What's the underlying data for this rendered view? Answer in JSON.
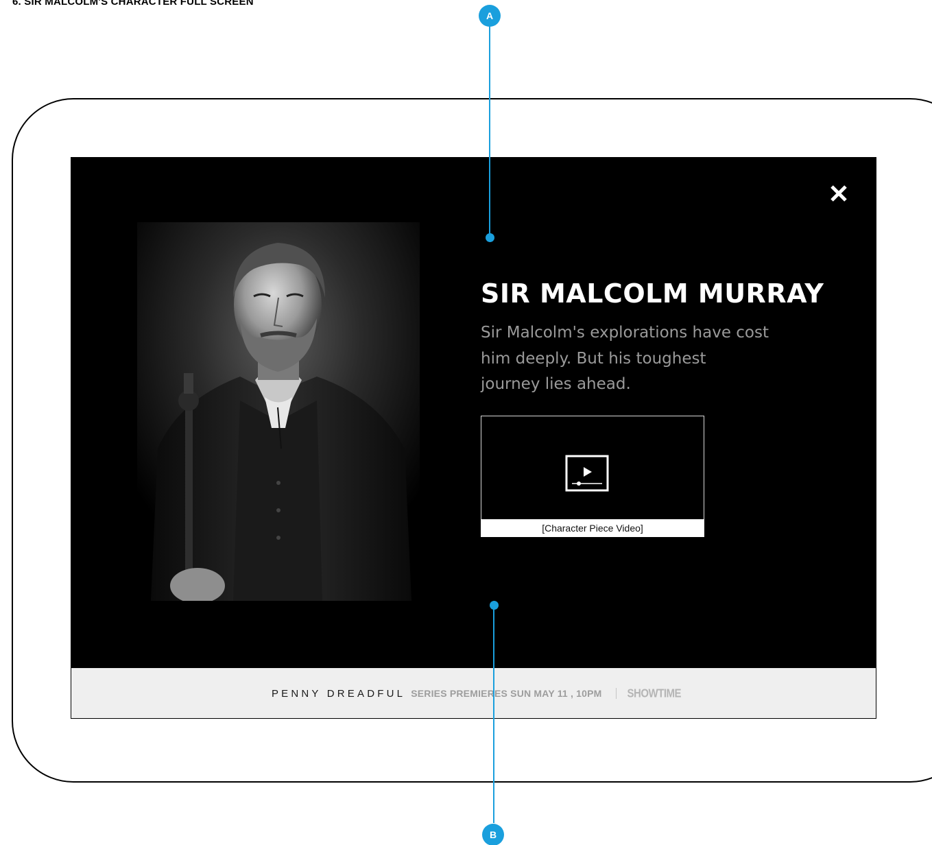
{
  "doc": {
    "title": "6. SIR MALCOLM'S CHARACTER FULL SCREEN"
  },
  "annotations": {
    "a_label": "A",
    "b_label": "B",
    "color": "#1a9fdd"
  },
  "modal": {
    "close_label": "X",
    "character_name": "SIR MALCOLM MURRAY",
    "description": "Sir Malcolm's explorations have cost him deeply. But his toughest journey lies ahead.",
    "video_caption": "[Character Piece Video]",
    "video_icon": "play-video-icon",
    "portrait_alt": "Sir Malcolm Murray portrait"
  },
  "promo": {
    "show": "PENNY DREADFUL",
    "premiere": "SERIES PREMIERES SUN MAY 11 , 10PM",
    "network": "SHOWTIME"
  }
}
